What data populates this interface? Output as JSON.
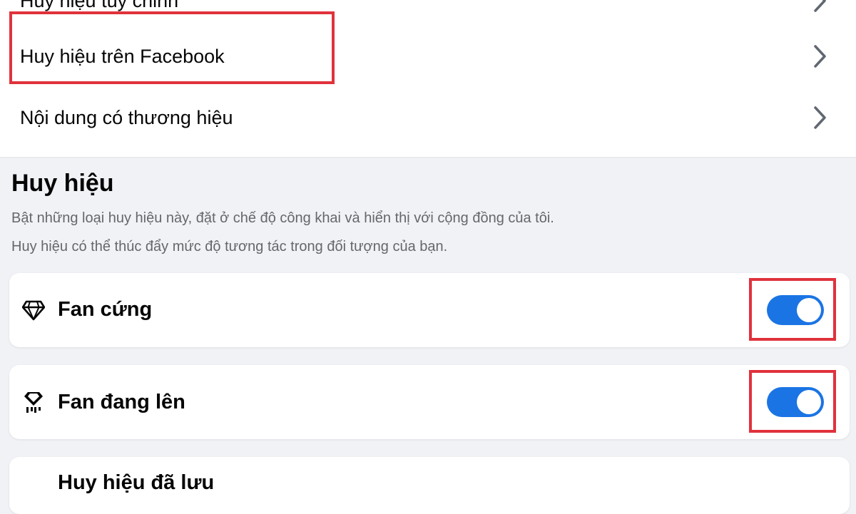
{
  "menu": {
    "items": [
      {
        "label": "Huy hiệu tùy chỉnh"
      },
      {
        "label": "Huy hiệu trên Facebook"
      },
      {
        "label": "Nội dung có thương hiệu"
      }
    ]
  },
  "badges_section": {
    "title": "Huy hiệu",
    "description_1": "Bật những loại huy hiệu này, đặt ở chế độ công khai và hiển thị với cộng đồng của tôi.",
    "description_2": "Huy hiệu có thể thúc đẩy mức độ tương tác trong đối tượng của bạn.",
    "badges": [
      {
        "label": "Fan cứng",
        "icon": "diamond-icon",
        "enabled": true
      },
      {
        "label": "Fan đang lên",
        "icon": "rising-fan-icon",
        "enabled": true
      },
      {
        "label": "Huy hiệu đã lưu",
        "icon": "",
        "enabled": null
      }
    ]
  },
  "colors": {
    "toggle_on": "#1b74e4",
    "highlight": "#e0323c",
    "background": "#f0f2f5"
  }
}
